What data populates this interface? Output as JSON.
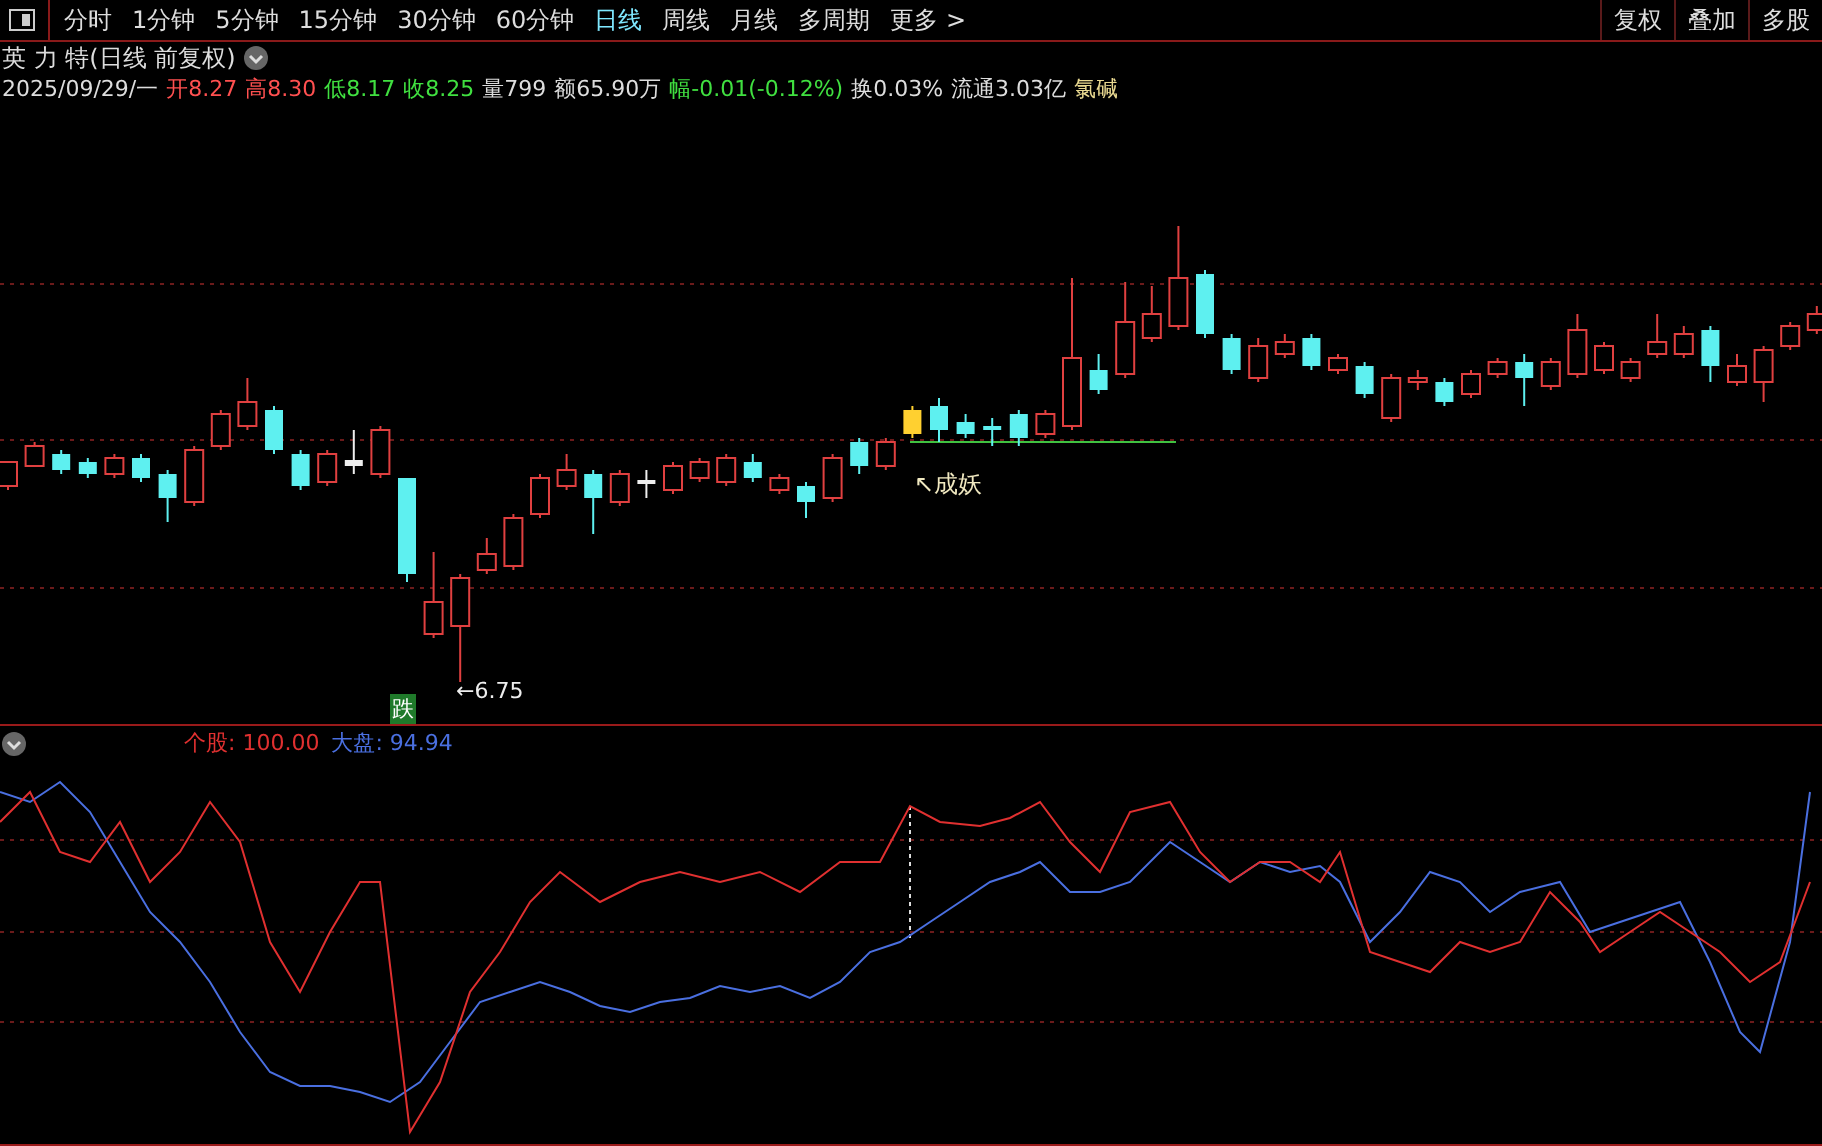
{
  "toolbar": {
    "tabs": [
      {
        "label": "分时",
        "selected": false
      },
      {
        "label": "1分钟",
        "selected": false
      },
      {
        "label": "5分钟",
        "selected": false
      },
      {
        "label": "15分钟",
        "selected": false
      },
      {
        "label": "30分钟",
        "selected": false
      },
      {
        "label": "60分钟",
        "selected": false
      },
      {
        "label": "日线",
        "selected": true
      },
      {
        "label": "周线",
        "selected": false
      },
      {
        "label": "月线",
        "selected": false
      },
      {
        "label": "多周期",
        "selected": false
      }
    ],
    "more": "更多 >",
    "buttons": [
      "复权",
      "叠加",
      "多股"
    ]
  },
  "stock": {
    "title": "英 力 特(日线 前复权)",
    "quote": [
      {
        "kind": "plain",
        "text": "2025/09/29/一"
      },
      {
        "kind": "up",
        "text": "开8.27"
      },
      {
        "kind": "up",
        "text": "高8.30"
      },
      {
        "kind": "down",
        "text": "低8.17"
      },
      {
        "kind": "down",
        "text": "收8.25"
      },
      {
        "kind": "plain",
        "text": "量799"
      },
      {
        "kind": "plain",
        "text": "额65.90万"
      },
      {
        "kind": "down",
        "text": "幅-0.01(-0.12%)"
      },
      {
        "kind": "plain",
        "text": "换0.03%"
      },
      {
        "kind": "plain",
        "text": "流通3.03亿"
      },
      {
        "kind": "tag",
        "text": "氯碱"
      }
    ]
  },
  "chart": {
    "annotation": "↖成妖",
    "low_label": "←6.75",
    "signal": "跌"
  },
  "indicator": {
    "legend": [
      {
        "label": "个股: 100.00",
        "color": "#e03030"
      },
      {
        "label": "大盘: 94.94",
        "color": "#4a6fe0"
      }
    ]
  }
}
